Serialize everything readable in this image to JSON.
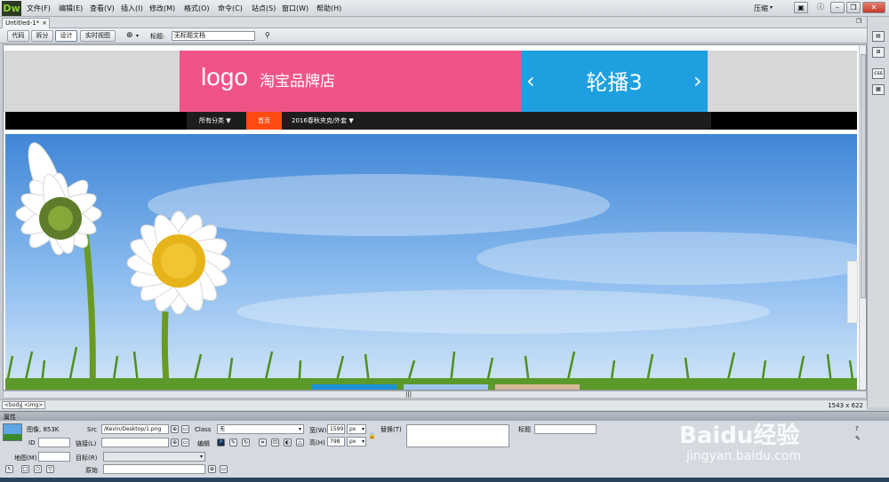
{
  "app": {
    "logo": "Dw",
    "menus": [
      "文件(F)",
      "编辑(E)",
      "查看(V)",
      "插入(I)",
      "修改(M)",
      "格式(O)",
      "命令(C)",
      "站点(S)",
      "窗口(W)",
      "帮助(H)"
    ],
    "workspace": "压缩"
  },
  "tab": {
    "title": "Untitled-1*",
    "close": "×"
  },
  "toolbar": {
    "views": [
      "代码",
      "拆分",
      "设计",
      "实时视图"
    ],
    "title_label": "标题:",
    "title_value": "无标题文档"
  },
  "page": {
    "logo_text": "logo",
    "shop_name": "淘宝品牌店",
    "carousel_text": "轮播3",
    "prev_arrow": "‹",
    "next_arrow": "›",
    "nav": {
      "all": "所有分类 ▼",
      "home": "首页",
      "season": "2016春秋夹克/外套  ▼"
    }
  },
  "status": {
    "tags": [
      "<body>",
      "<img>"
    ],
    "dimensions": "1543 x 622"
  },
  "properties": {
    "panel_title": "属性",
    "type_label": "图像, 853K",
    "id_label": "ID",
    "src_label": "Src",
    "src_value": "/Kevin/Desktop/1.png",
    "link_label": "链接(L)",
    "class_label": "Class",
    "class_value": "无",
    "edit_label": "编辑",
    "width_label": "宽(W)",
    "width_value": "1599",
    "height_label": "高(H)",
    "height_value": "798",
    "unit": "px",
    "alt_label": "替换(T)",
    "title_label": "标题",
    "map_label": "地图(M)",
    "target_label": "目标(R)",
    "original_label": "原始"
  },
  "watermark": {
    "main": "Baidu经验",
    "sub": "jingyan.baidu.com"
  },
  "colors": {
    "brand_pink": "#f05486",
    "carousel_blue": "#1ea0e0",
    "nav_home": "#ff4a12"
  }
}
